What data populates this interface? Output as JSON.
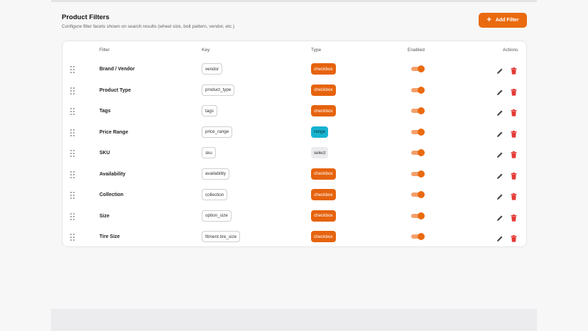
{
  "header": {
    "title": "Product Filters",
    "subtitle": "Configure filter facets shown on search results (wheel size, bolt pattern, vendor, etc.)",
    "add_button_label": "Add Filter",
    "add_button_icon": "plus-icon"
  },
  "table": {
    "columns": [
      "Filter",
      "Key",
      "Type",
      "Enabled",
      "Actions"
    ],
    "rows": [
      {
        "name": "Brand / Vendor",
        "key": "vendor",
        "type": "checkbox",
        "enabled": true
      },
      {
        "name": "Product Type",
        "key": "product_type",
        "type": "checkbox",
        "enabled": true
      },
      {
        "name": "Tags",
        "key": "tags",
        "type": "checkbox",
        "enabled": true
      },
      {
        "name": "Price Range",
        "key": "price_range",
        "type": "range",
        "enabled": true
      },
      {
        "name": "SKU",
        "key": "sku",
        "type": "select",
        "enabled": true
      },
      {
        "name": "Availability",
        "key": "availability",
        "type": "checkbox",
        "enabled": true
      },
      {
        "name": "Collection",
        "key": "collection",
        "type": "checkbox",
        "enabled": true
      },
      {
        "name": "Size",
        "key": "option_size",
        "type": "checkbox",
        "enabled": true
      },
      {
        "name": "Tire Size",
        "key": "fitment.tire_size",
        "type": "checkbox",
        "enabled": true
      }
    ]
  },
  "colors": {
    "accent": "#ea6a10",
    "toggle_track": "#f4a06a",
    "range_badge": "#16b3cf",
    "select_badge": "#ebebee",
    "delete_icon": "#e53935"
  },
  "icons": {
    "drag": "drag-handle-icon",
    "edit": "pencil-icon",
    "delete": "trash-icon"
  }
}
